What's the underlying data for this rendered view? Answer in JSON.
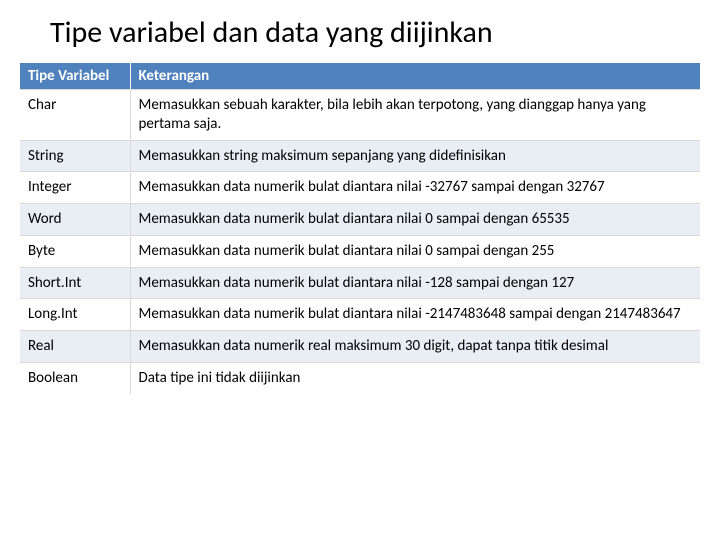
{
  "title": "Tipe variabel dan data yang diijinkan",
  "headers": {
    "col1": "Tipe Variabel",
    "col2": "Keterangan"
  },
  "rows": [
    {
      "type": "Char",
      "desc": "Memasukkan sebuah karakter, bila lebih akan terpotong, yang dianggap hanya yang pertama saja."
    },
    {
      "type": "String",
      "desc": "Memasukkan string maksimum sepanjang yang didefinisikan"
    },
    {
      "type": "Integer",
      "desc": "Memasukkan data numerik bulat diantara nilai -32767 sampai dengan 32767"
    },
    {
      "type": "Word",
      "desc": "Memasukkan data numerik bulat diantara nilai 0 sampai dengan 65535"
    },
    {
      "type": "Byte",
      "desc": "Memasukkan data numerik bulat diantara nilai 0 sampai dengan 255"
    },
    {
      "type": "Short.Int",
      "desc": "Memasukkan data numerik bulat diantara nilai -128 sampai dengan 127"
    },
    {
      "type": "Long.Int",
      "desc": "Memasukkan data numerik bulat diantara nilai -2147483648 sampai dengan 2147483647"
    },
    {
      "type": "Real",
      "desc": "Memasukkan data numerik real maksimum 30 digit, dapat tanpa titik desimal"
    },
    {
      "type": "Boolean",
      "desc": "Data tipe ini tidak diijinkan"
    }
  ]
}
